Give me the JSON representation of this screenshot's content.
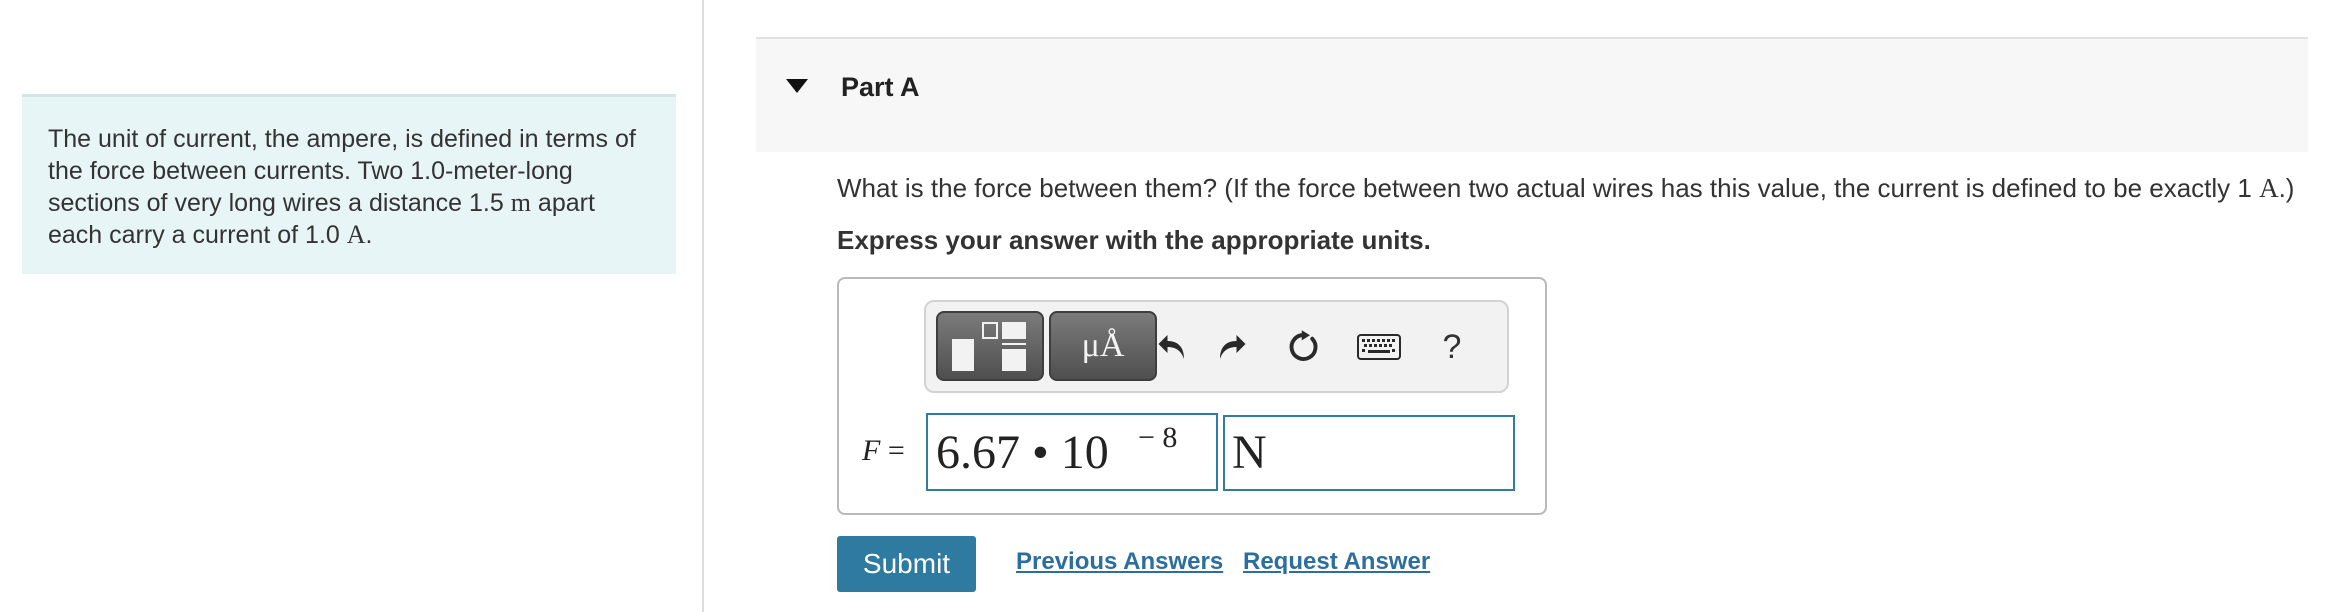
{
  "problem": {
    "text_parts": [
      "The unit of current, the ampere, is defined in terms of the force between currents. Two 1.0-meter-long sections of very long wires a distance 1.5 ",
      "m",
      " apart each carry a current of 1.0 ",
      "A",
      "."
    ]
  },
  "part": {
    "title": "Part A",
    "question_parts": [
      "What is the force between them? (If the force between two actual wires has this value, the current is defined to be exactly 1 ",
      "A",
      ".)"
    ],
    "instruction": "Express your answer with the appropriate units."
  },
  "toolbar": {
    "units_label": "μÅ",
    "help_label": "?",
    "icons": [
      "templates-icon",
      "units-icon",
      "undo-icon",
      "redo-icon",
      "reset-icon",
      "keyboard-icon",
      "help-icon"
    ]
  },
  "answer": {
    "variable": "F",
    "equals": " =",
    "value_mantissa": "6.67 • 10",
    "value_exponent": "− 8",
    "unit_value": "N"
  },
  "actions": {
    "submit_label": "Submit",
    "previous_answers_label": "Previous Answers",
    "request_answer_label": "Request Answer"
  },
  "colors": {
    "problem_bg": "#e8f5f6",
    "accent": "#2e7aa0",
    "link": "#2c6e9e",
    "field_border": "#2f7da0"
  }
}
